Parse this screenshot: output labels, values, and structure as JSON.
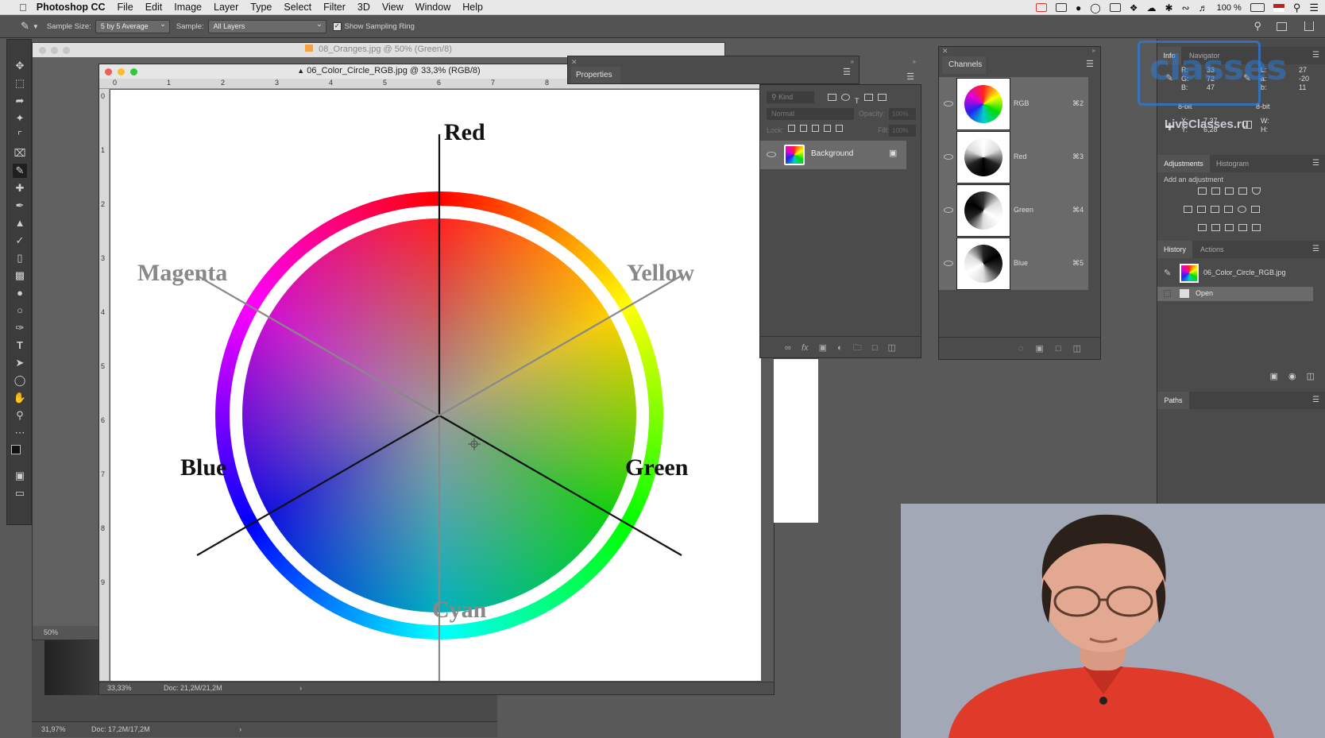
{
  "menubar": {
    "app_name": "Photoshop CC",
    "items": [
      "File",
      "Edit",
      "Image",
      "Layer",
      "Type",
      "Select",
      "Filter",
      "3D",
      "View",
      "Window",
      "Help"
    ],
    "battery": "100 %"
  },
  "options_bar": {
    "sample_size_label": "Sample Size:",
    "sample_size_value": "5 by 5 Average",
    "sample_label": "Sample:",
    "sample_value": "All Layers",
    "show_ring_label": "Show Sampling Ring"
  },
  "doc_oranges": {
    "title": "08_Oranges.jpg @ 50% (Green/8)",
    "zoom": "50%"
  },
  "doc_bg": {
    "zoom": "31,97%",
    "doc_info": "Doc: 17,2M/17,2M"
  },
  "doc_main": {
    "title": "06_Color_Circle_RGB.jpg @ 33,3% (RGB/8)",
    "zoom": "33,33%",
    "doc_info": "Doc: 21,2M/21,2M",
    "ruler_marks": [
      "0",
      "1",
      "2",
      "3",
      "4",
      "5",
      "6",
      "7",
      "8"
    ],
    "vruler_marks": [
      "0",
      "1",
      "2",
      "3",
      "4",
      "5",
      "6",
      "7",
      "8",
      "9"
    ]
  },
  "color_wheel": {
    "labels": {
      "red": "Red",
      "yellow": "Yellow",
      "green": "Green",
      "cyan": "Cyan",
      "blue": "Blue",
      "magenta": "Magenta"
    }
  },
  "properties_panel": {
    "title": "Properties"
  },
  "layers_panel": {
    "filter_placeholder": "Kind",
    "blend_mode": "Normal",
    "opacity_label": "Opacity:",
    "opacity_value": "100%",
    "lock_label": "Lock:",
    "fill_label": "Fill:",
    "fill_value": "100%",
    "layer_name": "Background"
  },
  "channels_panel": {
    "title": "Channels",
    "channels": [
      {
        "name": "RGB",
        "shortcut": "⌘2"
      },
      {
        "name": "Red",
        "shortcut": "⌘3"
      },
      {
        "name": "Green",
        "shortcut": "⌘4"
      },
      {
        "name": "Blue",
        "shortcut": "⌘5"
      }
    ]
  },
  "info_panel": {
    "tabs": [
      "Info",
      "Navigator"
    ],
    "r_label": "R:",
    "r": "33",
    "g_label": "G:",
    "g": "72",
    "b_label": "B:",
    "b": "47",
    "l_label": "L:",
    "l": "27",
    "a_label": "a:",
    "a": "-20",
    "bb_label": "b:",
    "bb": "11",
    "bit_left": "8-bit",
    "bit_right": "8-bit",
    "x_label": "X:",
    "x": "7,37",
    "y_label": "Y:",
    "y": "6,28",
    "w_label": "W:",
    "h_label": "H:"
  },
  "adjustments_panel": {
    "tabs": [
      "Adjustments",
      "Histogram"
    ],
    "hint": "Add an adjustment"
  },
  "history_panel": {
    "tabs": [
      "History",
      "Actions"
    ],
    "snapshot": "06_Color_Circle_RGB.jpg",
    "steps": [
      "Open"
    ]
  },
  "paths_panel": {
    "title": "Paths"
  },
  "watermark": {
    "logo": "classes",
    "site": "LiveClasses.ru"
  },
  "colors": {
    "accent": "#2f7bd6",
    "presenter_shirt": "#e03a2b",
    "webcam_bg": "#9fa6b4"
  }
}
